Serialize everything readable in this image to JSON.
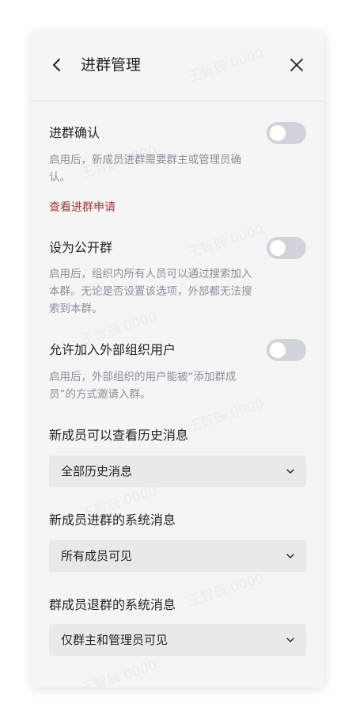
{
  "header": {
    "title": "进群管理",
    "back_icon": "chevron-left-icon",
    "close_icon": "close-icon"
  },
  "watermark": "王智辰 0000",
  "sections": {
    "join_confirm": {
      "title": "进群确认",
      "desc": "启用后，新成员进群需要群主或管理员确认。",
      "link": "查看进群申请",
      "enabled": false
    },
    "public_group": {
      "title": "设为公开群",
      "desc": "启用后，组织内所有人员可以通过搜索加入本群。无论是否设置该选项，外部都无法搜索到本群。",
      "enabled": false
    },
    "external_users": {
      "title": "允许加入外部组织用户",
      "desc": "启用后，外部组织的用户能被“添加群成员”的方式邀请入群。",
      "enabled": false
    },
    "history": {
      "title": "新成员可以查看历史消息",
      "value": "全部历史消息"
    },
    "join_msg": {
      "title": "新成员进群的系统消息",
      "value": "所有成员可见"
    },
    "leave_msg": {
      "title": "群成员退群的系统消息",
      "value": "仅群主和管理员可见"
    }
  },
  "colors": {
    "link": "#a33a3a",
    "toggle_off": "#d0d3d9",
    "background": "#f5f5f6"
  }
}
